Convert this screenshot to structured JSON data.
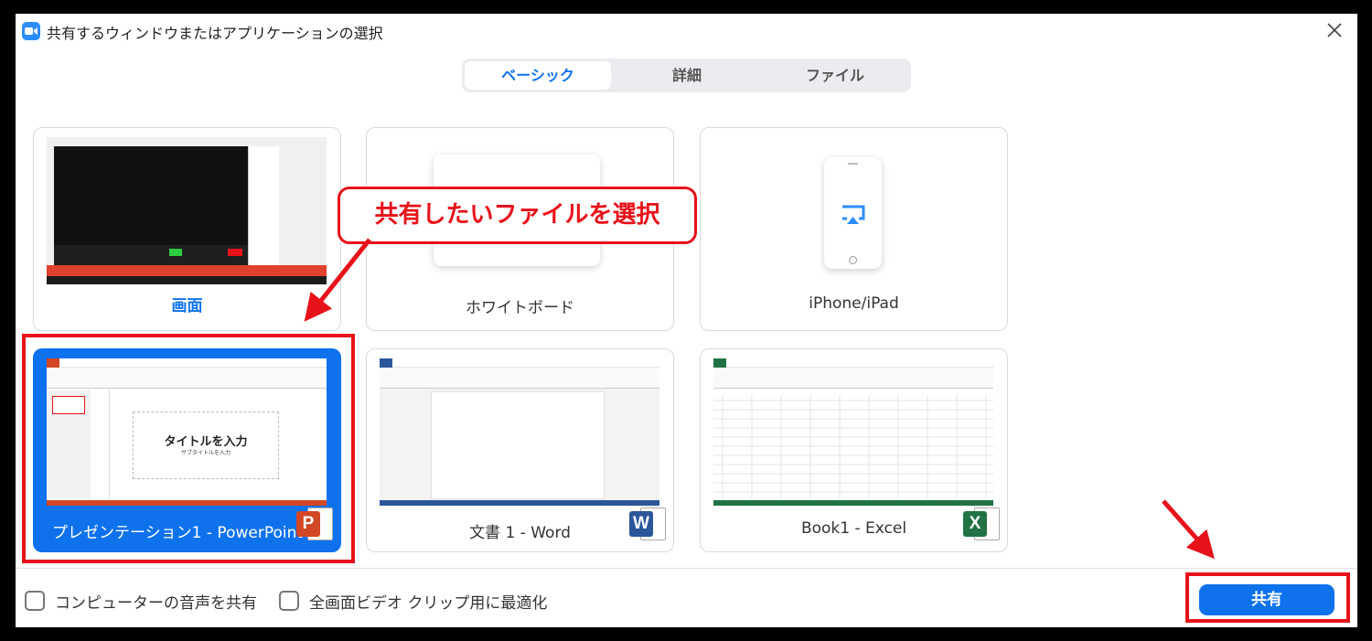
{
  "window": {
    "title": "共有するウィンドウまたはアプリケーションの選択"
  },
  "tabs": [
    {
      "label": "ベーシック",
      "active": true
    },
    {
      "label": "詳細",
      "active": false
    },
    {
      "label": "ファイル",
      "active": false
    }
  ],
  "cards": {
    "screen": {
      "label": "画面",
      "selected": false
    },
    "whiteboard": {
      "label": "ホワイトボード"
    },
    "iphone": {
      "label": "iPhone/iPad"
    },
    "powerpoint": {
      "label": "プレゼンテーション1 - PowerPoint",
      "selected": true,
      "slide_title": "タイトルを入力",
      "slide_subtitle": "サブタイトルを入力",
      "badge": "P"
    },
    "word": {
      "label": "文書 1 - Word",
      "badge": "W"
    },
    "excel": {
      "label": "Book1 - Excel",
      "badge": "X"
    }
  },
  "annotation": {
    "callout": "共有したいファイルを選択"
  },
  "footer": {
    "audio_checkbox": {
      "label": "コンピューターの音声を共有",
      "checked": false
    },
    "video_checkbox": {
      "label": "全画面ビデオ クリップ用に最適化",
      "checked": false
    },
    "share_button": "共有"
  },
  "colors": {
    "accent": "#0e72ed",
    "annotation": "#e8121a",
    "powerpoint": "#d24726",
    "word": "#2b579a",
    "excel": "#217346"
  }
}
